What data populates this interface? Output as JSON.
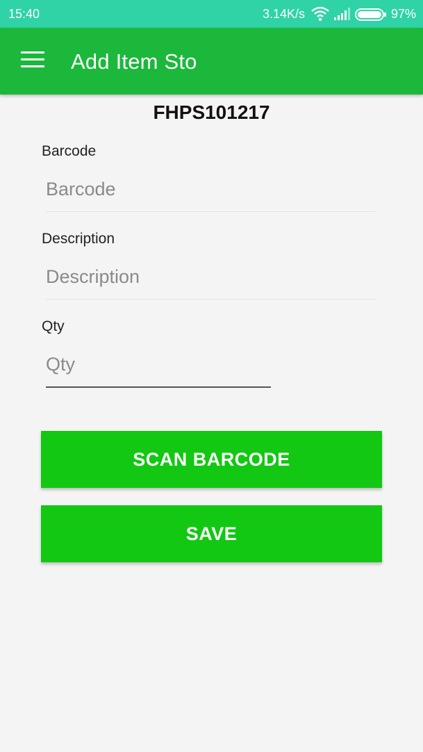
{
  "status_bar": {
    "time": "15:40",
    "network_speed": "3.14K/s",
    "battery": "97%",
    "icons": [
      "wifi-icon",
      "signal-icon",
      "battery-icon"
    ]
  },
  "app_bar": {
    "title": "Add Item Sto",
    "menu_icon": "menu-icon"
  },
  "item_code": "FHPS101217",
  "form": {
    "barcode": {
      "label": "Barcode",
      "placeholder": "Barcode",
      "value": ""
    },
    "description": {
      "label": "Description",
      "placeholder": "Description",
      "value": ""
    },
    "qty": {
      "label": "Qty",
      "placeholder": "Qty",
      "value": ""
    }
  },
  "buttons": {
    "scan": "SCAN BARCODE",
    "save": "SAVE"
  },
  "colors": {
    "status_bar": "#2fd3a6",
    "app_bar": "#1cb83c",
    "button": "#12c812",
    "background": "#f4f4f4"
  }
}
